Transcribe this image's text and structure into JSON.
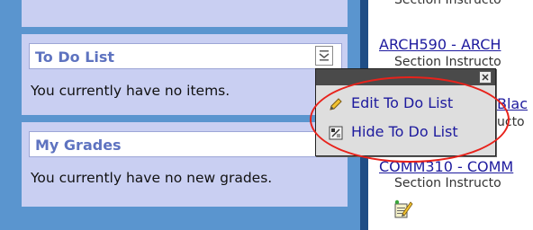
{
  "left_panel": {
    "top_module_text": "",
    "todo": {
      "title": "To Do List",
      "body": "You currently have no items."
    },
    "grades": {
      "title": "My Grades",
      "body": "You currently have no new grades."
    }
  },
  "popup_menu": {
    "items": [
      {
        "label": "Edit To Do List",
        "icon": "pencil-icon"
      },
      {
        "label": "Hide To Do List",
        "icon": "hide-icon"
      }
    ]
  },
  "right_panel": {
    "top_instructor": "Section Instructo",
    "courses": [
      {
        "label": "ARCH590 - ARCH",
        "instructor": "Section Instructo"
      },
      {
        "label": "Blac",
        "instructor": "ucto"
      },
      {
        "label": "COMM310 - COMM",
        "instructor": "Section Instructo"
      }
    ]
  },
  "colors": {
    "sidebar": "#5a95cf",
    "module_bg": "#c9cff2",
    "title_text": "#5e73c0",
    "link": "#1d1a9e",
    "highlight": "#e8221b"
  }
}
